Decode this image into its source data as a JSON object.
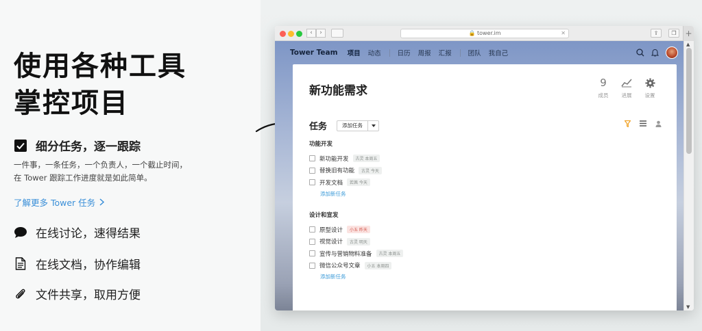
{
  "hero": {
    "line1": "使用各种工具",
    "line2": "掌控项目"
  },
  "features": [
    {
      "label": "细分任务，逐一跟踪",
      "icon": "checkbox-checked-icon"
    },
    {
      "label": "在线讨论，速得结果",
      "icon": "speech-bubble-icon"
    },
    {
      "label": "在线文档，协作编辑",
      "icon": "document-icon"
    },
    {
      "label": "文件共享，取用方便",
      "icon": "paperclip-icon"
    }
  ],
  "feature_desc": {
    "line1": "一件事，一条任务，一个负责人，一个截止时间，",
    "line2": "在 Tower 跟踪工作进度就是如此简单。"
  },
  "learn_more": "了解更多 Tower 任务",
  "browser": {
    "url": "tower.im",
    "plus": "+"
  },
  "appnav": {
    "brand": "Tower Team",
    "items": [
      "项目",
      "动态",
      "日历",
      "周报",
      "汇报",
      "团队",
      "我自己"
    ],
    "active": "项目"
  },
  "project": {
    "title": "新功能需求",
    "stats": [
      {
        "value": "9",
        "label": "成员"
      },
      {
        "label": "进展",
        "icon": "chart-icon"
      },
      {
        "label": "设置",
        "icon": "gear-icon"
      }
    ]
  },
  "tasks": {
    "title": "任务",
    "add_button": "添加任务",
    "groups": [
      {
        "title": "功能开发",
        "items": [
          {
            "name": "新功能开发",
            "tag": "古灵 本周五",
            "tag_style": "gray"
          },
          {
            "name": "替换旧有功能",
            "tag": "古灵 今天",
            "tag_style": "gray"
          },
          {
            "name": "开发文档",
            "tag": "若茜 今天",
            "tag_style": "gray"
          }
        ],
        "add_new": "添加新任务"
      },
      {
        "title": "设计和宣发",
        "items": [
          {
            "name": "原型设计",
            "tag": "小五 昨天",
            "tag_style": "red"
          },
          {
            "name": "视觉设计",
            "tag": "古灵 明天",
            "tag_style": "gray"
          },
          {
            "name": "宣传与营销物料准备",
            "tag": "古灵 本周五",
            "tag_style": "gray"
          },
          {
            "name": "微信公众号文章",
            "tag": "小五 本周四",
            "tag_style": "gray"
          }
        ],
        "add_new": "添加新任务"
      }
    ]
  },
  "colors": {
    "link": "#3a9ad8",
    "filter_icon": "#f0a020",
    "overdue_tag": "#d2574c"
  }
}
